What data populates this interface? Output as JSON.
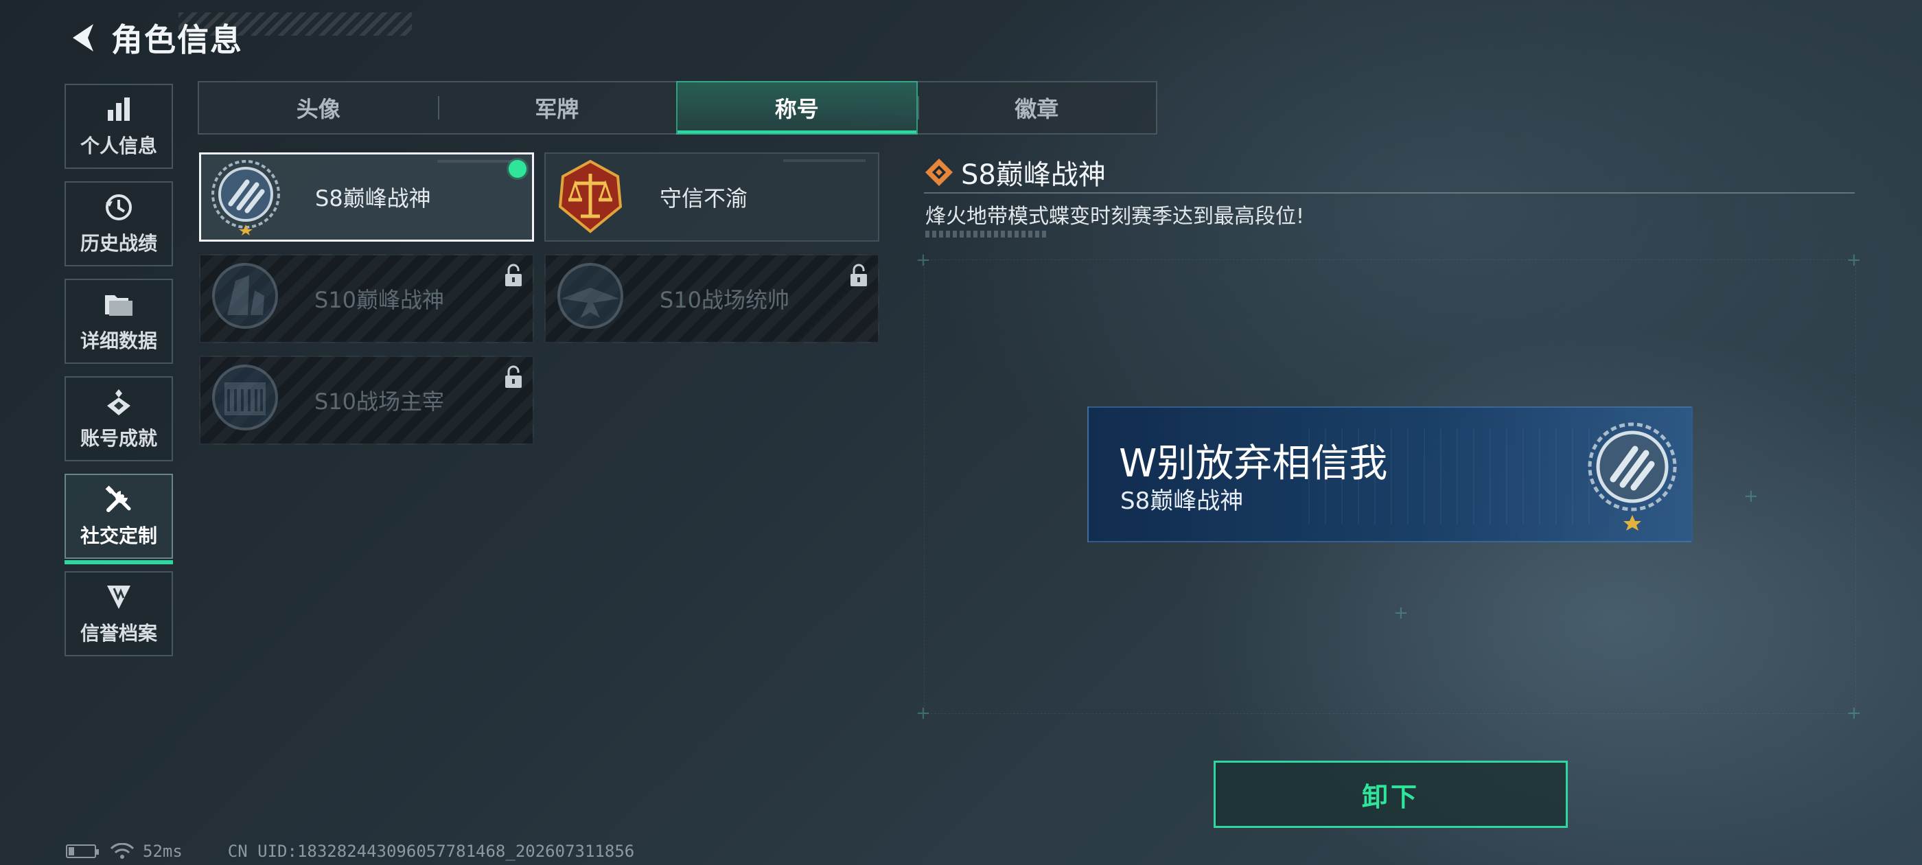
{
  "header": {
    "title": "角色信息"
  },
  "sidebar": {
    "items": [
      {
        "label": "个人信息",
        "icon": "bar-chart-icon"
      },
      {
        "label": "历史战绩",
        "icon": "history-icon"
      },
      {
        "label": "详细数据",
        "icon": "folder-icon"
      },
      {
        "label": "账号成就",
        "icon": "achievement-icon"
      },
      {
        "label": "社交定制",
        "icon": "tools-icon",
        "active": true
      },
      {
        "label": "信誉档案",
        "icon": "credit-icon"
      }
    ]
  },
  "tabs": [
    {
      "label": "头像"
    },
    {
      "label": "军牌"
    },
    {
      "label": "称号",
      "active": true
    },
    {
      "label": "徽章"
    }
  ],
  "titles": [
    {
      "name": "S8巅峰战神",
      "selected": true,
      "locked": false,
      "equipped": true,
      "icon": "laurel-stripes-emblem-icon"
    },
    {
      "name": "守信不渝",
      "selected": false,
      "locked": false,
      "equipped": false,
      "icon": "scales-badge-icon"
    },
    {
      "name": "S10巅峰战神",
      "selected": false,
      "locked": true,
      "equipped": false,
      "icon": "tower-emblem-icon"
    },
    {
      "name": "S10战场统帅",
      "selected": false,
      "locked": true,
      "equipped": false,
      "icon": "aircraft-emblem-icon"
    },
    {
      "name": "S10战场主宰",
      "selected": false,
      "locked": true,
      "equipped": false,
      "icon": "colosseum-emblem-icon"
    }
  ],
  "detail": {
    "title": "S8巅峰战神",
    "description": "烽火地带模式蝶变时刻赛季达到最高段位!"
  },
  "preview": {
    "player_name": "W别放弃相信我",
    "title": "S8巅峰战神"
  },
  "actions": {
    "unequip_label": "卸下"
  },
  "status": {
    "ping": "52ms",
    "uid": "CN UID:1832824430960577814 68_202607311856"
  },
  "colors": {
    "accent": "#2fd6a0",
    "equipped_dot": "#2fe59a",
    "preview_bg": "#1a4470"
  }
}
